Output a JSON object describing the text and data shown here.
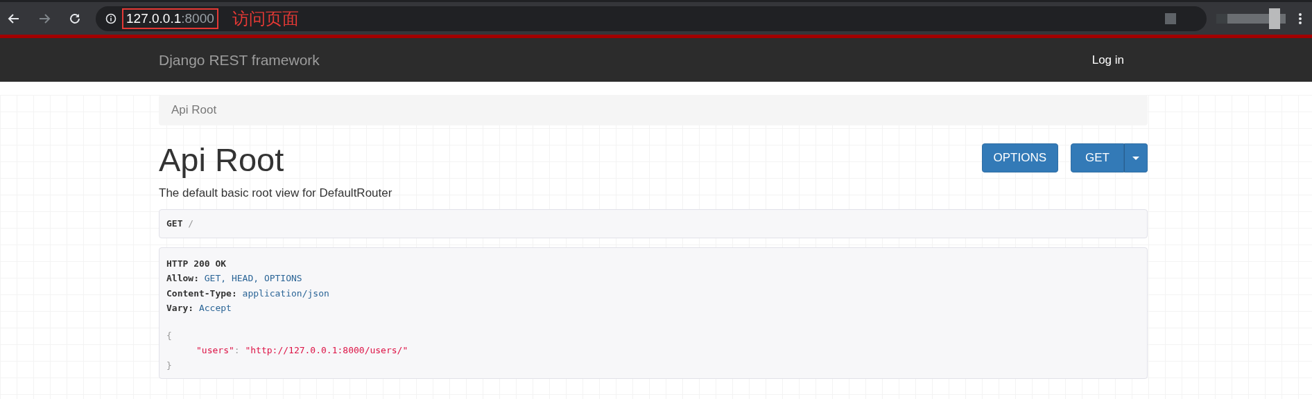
{
  "browser": {
    "url_host": "127.0.0.1",
    "url_port": ":8000",
    "annotation": "访问页面"
  },
  "navbar": {
    "brand": "Django REST framework",
    "login": "Log in"
  },
  "breadcrumb": [
    {
      "label": "Api Root",
      "selected": true
    }
  ],
  "title": "Api Root",
  "description": "The default basic root view for DefaultRouter",
  "buttons": [
    {
      "label": "OPTIONS",
      "kind": "plain"
    },
    {
      "label": "GET",
      "kind": "split"
    }
  ],
  "request": {
    "method": "GET",
    "path": "/"
  },
  "response": {
    "status": "HTTP 200 OK",
    "headers": [
      {
        "name": "Allow:",
        "value": "GET, HEAD, OPTIONS"
      },
      {
        "name": "Content-Type:",
        "value": "application/json"
      },
      {
        "name": "Vary:",
        "value": "Accept"
      }
    ],
    "open": "{",
    "entries": [
      {
        "key": "\"users\"",
        "sep": ":",
        "value": "\"http://127.0.0.1:8000/users/\""
      }
    ],
    "close": "}"
  }
}
